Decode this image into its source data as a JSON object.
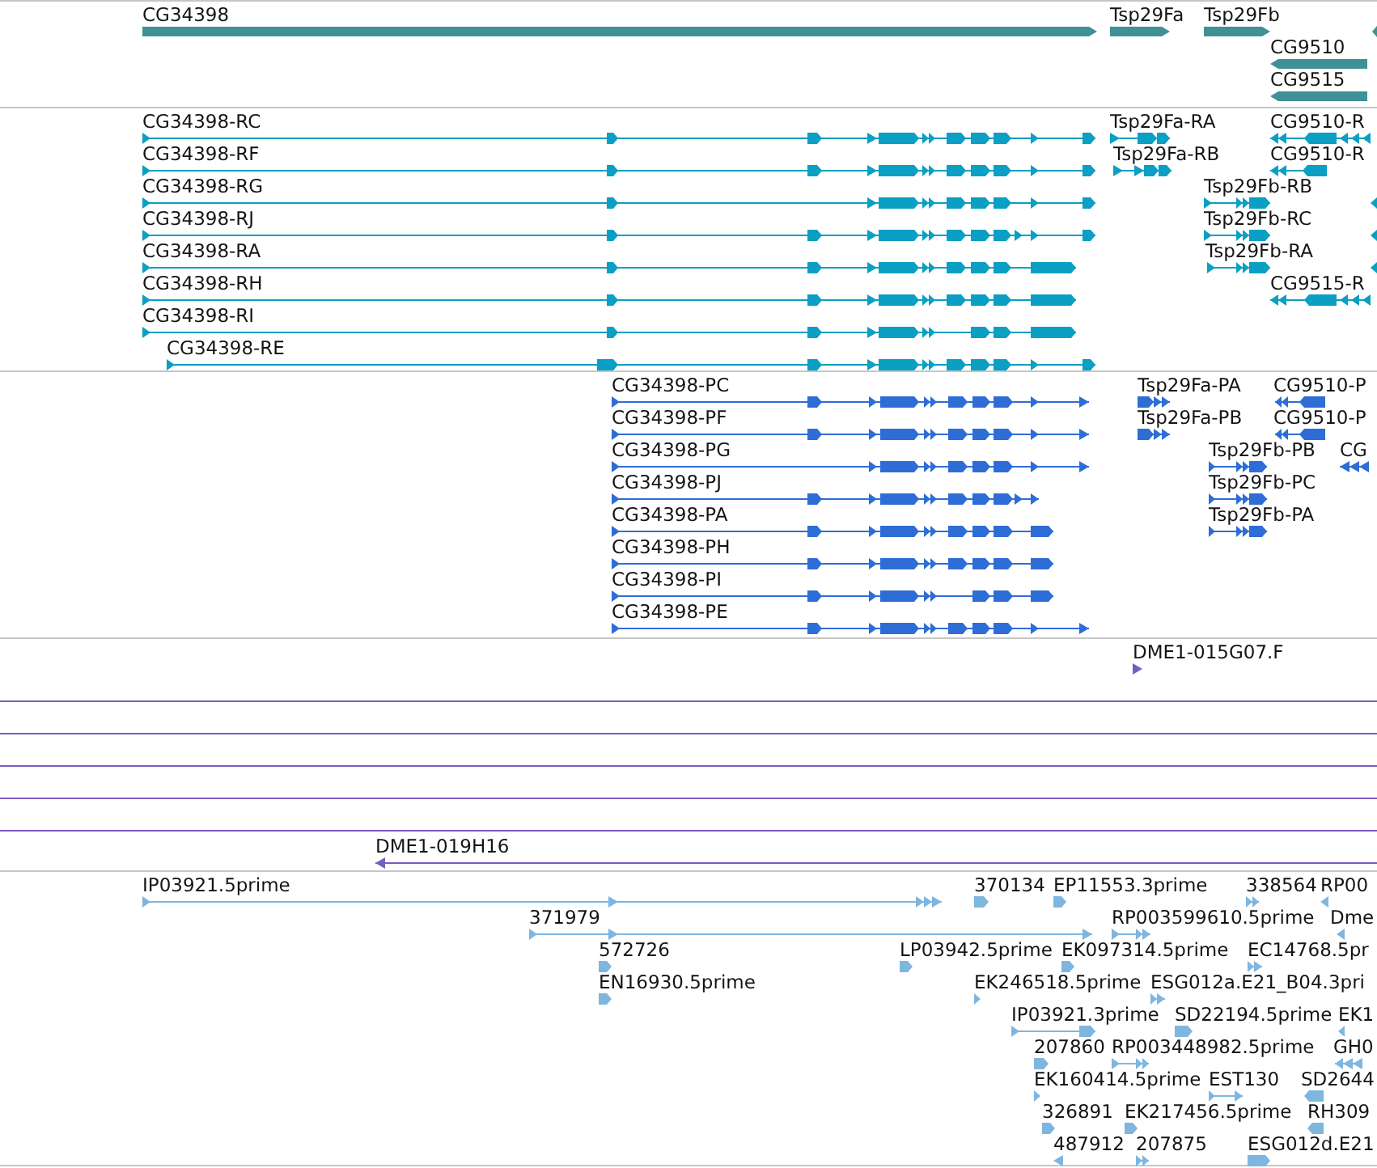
{
  "tracks": [
    {
      "kind": "gene",
      "rows": [
        {
          "features": [
            {
              "label": "CG34398",
              "reverse": false
            },
            {
              "label": "Tsp29Fa",
              "reverse": false
            },
            {
              "label": "Tsp29Fb",
              "reverse": false
            },
            {
              "reverse": true
            }
          ]
        },
        {
          "features": [
            {
              "label": "CG9510",
              "reverse": true
            }
          ]
        },
        {
          "features": [
            {
              "label": "CG9515",
              "reverse": true
            }
          ]
        }
      ]
    },
    {
      "kind": "transcript",
      "rows": [
        {
          "features": [
            {
              "label": "CG34398-RC",
              "reverse": false
            },
            {
              "label": "Tsp29Fa-RA",
              "reverse": false
            },
            {
              "label": "CG9510-R",
              "reverse": true
            }
          ]
        },
        {
          "features": [
            {
              "label": "CG34398-RF",
              "reverse": false
            },
            {
              "label": "Tsp29Fa-RB",
              "reverse": false
            },
            {
              "label": "CG9510-R",
              "reverse": true
            }
          ]
        },
        {
          "features": [
            {
              "label": "CG34398-RG",
              "reverse": false
            },
            {
              "label": "Tsp29Fb-RB",
              "reverse": false
            },
            {
              "reverse": true
            }
          ]
        },
        {
          "features": [
            {
              "label": "CG34398-RJ",
              "reverse": false
            },
            {
              "label": "Tsp29Fb-RC",
              "reverse": false
            },
            {
              "reverse": true
            }
          ]
        },
        {
          "features": [
            {
              "label": "CG34398-RA",
              "reverse": false
            },
            {
              "label": "Tsp29Fb-RA",
              "reverse": false
            },
            {
              "reverse": true
            }
          ]
        },
        {
          "features": [
            {
              "label": "CG34398-RH",
              "reverse": false
            },
            {
              "label": "CG9515-R",
              "reverse": true
            }
          ]
        },
        {
          "features": [
            {
              "label": "CG34398-RI",
              "reverse": false
            }
          ]
        },
        {
          "features": [
            {
              "label": "CG34398-RE",
              "reverse": false
            }
          ]
        }
      ]
    },
    {
      "kind": "polypeptide",
      "rows": [
        {
          "features": [
            {
              "label": "CG34398-PC",
              "reverse": false
            },
            {
              "label": "Tsp29Fa-PA",
              "reverse": false
            },
            {
              "label": "CG9510-P",
              "reverse": true
            }
          ]
        },
        {
          "features": [
            {
              "label": "CG34398-PF",
              "reverse": false
            },
            {
              "label": "Tsp29Fa-PB",
              "reverse": false
            },
            {
              "label": "CG9510-P",
              "reverse": true
            }
          ]
        },
        {
          "features": [
            {
              "label": "CG34398-PG",
              "reverse": false
            },
            {
              "label": "Tsp29Fb-PB",
              "reverse": false
            },
            {
              "label": "CG",
              "reverse": true
            }
          ]
        },
        {
          "features": [
            {
              "label": "CG34398-PJ",
              "reverse": false
            },
            {
              "label": "Tsp29Fb-PC",
              "reverse": false
            }
          ]
        },
        {
          "features": [
            {
              "label": "CG34398-PA",
              "reverse": false
            },
            {
              "label": "Tsp29Fb-PA",
              "reverse": false
            }
          ]
        },
        {
          "features": [
            {
              "label": "CG34398-PH",
              "reverse": false
            }
          ]
        },
        {
          "features": [
            {
              "label": "CG34398-PI",
              "reverse": false
            }
          ]
        },
        {
          "features": [
            {
              "label": "CG34398-PE",
              "reverse": false
            }
          ]
        }
      ]
    },
    {
      "kind": "clone",
      "rows": [
        {
          "features": [
            {
              "kind": "end",
              "label": "DME1-015G07.F",
              "reverse": false
            }
          ]
        },
        {
          "features": [
            {
              "kind": "span"
            }
          ]
        },
        {
          "features": [
            {
              "kind": "span"
            }
          ]
        },
        {
          "features": [
            {
              "kind": "span"
            }
          ]
        },
        {
          "features": [
            {
              "kind": "span"
            }
          ]
        },
        {
          "features": [
            {
              "kind": "span"
            }
          ]
        },
        {
          "features": [
            {
              "kind": "end",
              "label": "DME1-019H16",
              "reverse": true
            }
          ]
        }
      ]
    },
    {
      "kind": "est",
      "rows": [
        {
          "features": [
            {
              "label": "IP03921.5prime",
              "reverse": false
            },
            {
              "label": "370134",
              "reverse": false
            },
            {
              "label": "EP11553.3prime",
              "reverse": false
            },
            {
              "label": "338564",
              "reverse": false
            },
            {
              "label": "RP00",
              "reverse": true
            }
          ]
        },
        {
          "features": [
            {
              "label": "371979",
              "reverse": false
            },
            {
              "label": "RP003599610.5prime",
              "reverse": false
            },
            {
              "label": "Dme",
              "reverse": true
            }
          ]
        },
        {
          "features": [
            {
              "label": "572726",
              "reverse": false
            },
            {
              "label": "LP03942.5prime",
              "reverse": false
            },
            {
              "label": "EK097314.5prime",
              "reverse": false
            },
            {
              "label": "EC14768.5pr",
              "reverse": false
            }
          ]
        },
        {
          "features": [
            {
              "label": "EN16930.5prime",
              "reverse": false
            },
            {
              "label": "EK246518.5prime",
              "reverse": false
            },
            {
              "label": "ESG012a.E21_B04.3pri",
              "reverse": false
            }
          ]
        },
        {
          "features": [
            {
              "label": "IP03921.3prime",
              "reverse": false
            },
            {
              "label": "SD22194.5prime",
              "reverse": false
            },
            {
              "label": "EK1",
              "reverse": true
            }
          ]
        },
        {
          "features": [
            {
              "label": "207860",
              "reverse": false
            },
            {
              "label": "RP003448982.5prime",
              "reverse": false
            },
            {
              "label": "GH0",
              "reverse": true
            }
          ]
        },
        {
          "features": [
            {
              "label": "EK160414.5prime",
              "reverse": false
            },
            {
              "label": "EST130",
              "reverse": false
            },
            {
              "label": "SD2644",
              "reverse": true
            }
          ]
        },
        {
          "features": [
            {
              "label": "326891",
              "reverse": false
            },
            {
              "label": "EK217456.5prime",
              "reverse": false
            },
            {
              "label": "RH309",
              "reverse": true
            }
          ]
        },
        {
          "features": [
            {
              "label": "487912",
              "reverse": true
            },
            {
              "label": "207875",
              "reverse": false
            },
            {
              "label": "ESG012d.E21",
              "reverse": false
            }
          ]
        }
      ]
    }
  ]
}
